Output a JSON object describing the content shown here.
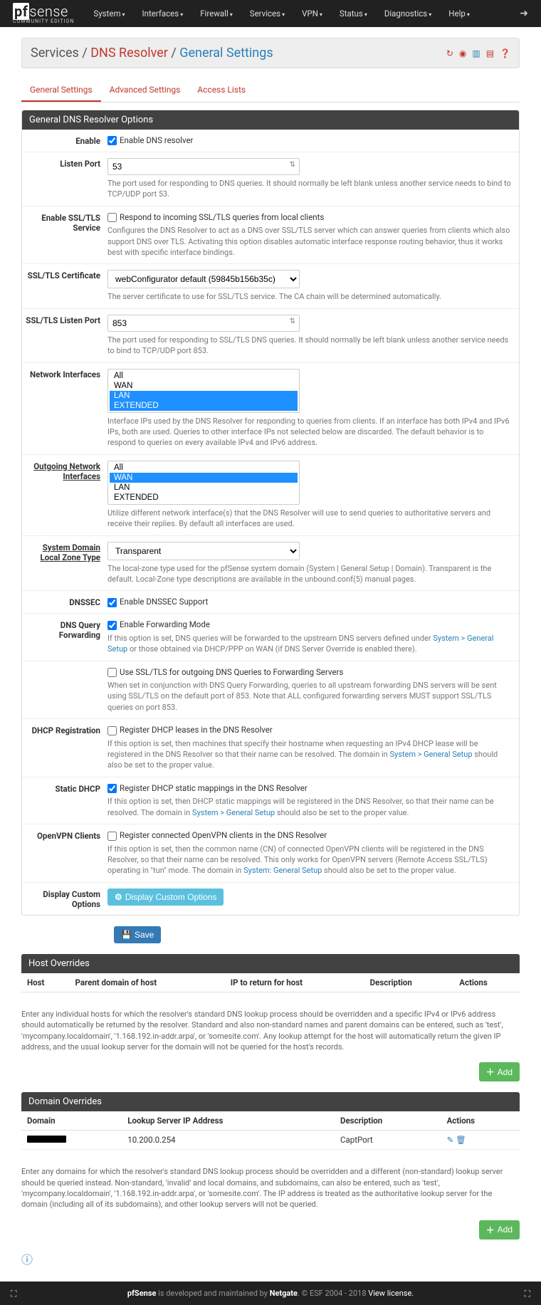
{
  "logo": {
    "brand_prefix": "pf",
    "brand_rest": "sense",
    "edition": "COMMUNITY EDITION"
  },
  "nav": [
    "System",
    "Interfaces",
    "Firewall",
    "Services",
    "VPN",
    "Status",
    "Diagnostics",
    "Help"
  ],
  "breadcrumb": {
    "a": "Services",
    "b": "DNS Resolver",
    "c": "General Settings"
  },
  "tabs": [
    "General Settings",
    "Advanced Settings",
    "Access Lists"
  ],
  "panel1_title": "General DNS Resolver Options",
  "enable": {
    "label": "Enable",
    "text": "Enable DNS resolver",
    "checked": true
  },
  "listen_port": {
    "label": "Listen Port",
    "value": "53",
    "help": "The port used for responding to DNS queries. It should normally be left blank unless another service needs to bind to TCP/UDP port 53."
  },
  "ssl_service": {
    "label": "Enable SSL/TLS Service",
    "text": "Respond to incoming SSL/TLS queries from local clients",
    "checked": false,
    "help": "Configures the DNS Resolver to act as a DNS over SSL/TLS server which can answer queries from clients which also support DNS over TLS. Activating this option disables automatic interface response routing behavior, thus it works best with specific interface bindings."
  },
  "ssl_cert": {
    "label": "SSL/TLS Certificate",
    "value": "webConfigurator default (59845b156b35c)",
    "help": "The server certificate to use for SSL/TLS service. The CA chain will be determined automatically."
  },
  "ssl_port": {
    "label": "SSL/TLS Listen Port",
    "value": "853",
    "help": "The port used for responding to SSL/TLS DNS queries. It should normally be left blank unless another service needs to bind to TCP/UDP port 853."
  },
  "net_if": {
    "label": "Network Interfaces",
    "options": [
      "All",
      "WAN",
      "LAN",
      "EXTENDED"
    ],
    "selected": [
      "LAN",
      "EXTENDED"
    ],
    "help": "Interface IPs used by the DNS Resolver for responding to queries from clients. If an interface has both IPv4 and IPv6 IPs, both are used. Queries to other interface IPs not selected below are discarded. The default behavior is to respond to queries on every available IPv4 and IPv6 address."
  },
  "out_if": {
    "label": "Outgoing Network Interfaces",
    "options": [
      "All",
      "WAN",
      "LAN",
      "EXTENDED"
    ],
    "selected": [
      "WAN"
    ],
    "help": "Utilize different network interface(s) that the DNS Resolver will use to send queries to authoritative servers and receive their replies. By default all interfaces are used."
  },
  "zone_type": {
    "label": "System Domain Local Zone Type",
    "value": "Transparent",
    "help": "The local-zone type used for the pfSense system domain (System | General Setup | Domain). Transparent is the default. Local-Zone type descriptions are available in the unbound.conf(5) manual pages."
  },
  "dnssec": {
    "label": "DNSSEC",
    "text": "Enable DNSSEC Support",
    "checked": true
  },
  "fwd": {
    "label": "DNS Query Forwarding",
    "text": "Enable Forwarding Mode",
    "checked": true,
    "help1": "If this option is set, DNS queries will be forwarded to the upstream DNS servers defined under ",
    "link": "System > General Setup",
    "help2": " or those obtained via DHCP/PPP on WAN (if DNS Server Override is enabled there)."
  },
  "fwd_ssl": {
    "text": "Use SSL/TLS for outgoing DNS Queries to Forwarding Servers",
    "checked": false,
    "help": "When set in conjunction with DNS Query Forwarding, queries to all upstream forwarding DNS servers will be sent using SSL/TLS on the default port of 853. Note that ALL configured forwarding servers MUST support SSL/TLS queries on port 853."
  },
  "dhcp_reg": {
    "label": "DHCP Registration",
    "text": "Register DHCP leases in the DNS Resolver",
    "checked": false,
    "help1": "If this option is set, then machines that specify their hostname when requesting an IPv4 DHCP lease will be registered in the DNS Resolver so that their name can be resolved. The domain in ",
    "link": "System > General Setup",
    "help2": " should also be set to the proper value."
  },
  "static_dhcp": {
    "label": "Static DHCP",
    "text": "Register DHCP static mappings in the DNS Resolver",
    "checked": true,
    "help1": "If this option is set, then DHCP static mappings will be registered in the DNS Resolver, so that their name can be resolved. The domain in ",
    "link": "System > General Setup",
    "help2": " should also be set to the proper value."
  },
  "openvpn": {
    "label": "OpenVPN Clients",
    "text": "Register connected OpenVPN clients in the DNS Resolver",
    "checked": false,
    "help1": "If this option is set, then the common name (CN) of connected OpenVPN clients will be registered in the DNS Resolver, so that their name can be resolved. This only works for OpenVPN servers (Remote Access SSL/TLS) operating in \"tun\" mode. The domain in ",
    "link": "System: General Setup",
    "help2": " should also be set to the proper value."
  },
  "custom": {
    "label": "Display Custom Options",
    "btn": "Display Custom Options"
  },
  "save_btn": "Save",
  "host_ov": {
    "title": "Host Overrides",
    "cols": [
      "Host",
      "Parent domain of host",
      "IP to return for host",
      "Description",
      "Actions"
    ],
    "desc": "Enter any individual hosts for which the resolver's standard DNS lookup process should be overridden and a specific IPv4 or IPv6 address should automatically be returned by the resolver. Standard and also non-standard names and parent domains can be entered, such as 'test', 'mycompany.localdomain', '1.168.192.in-addr.arpa', or 'somesite.com'. Any lookup attempt for the host will automatically return the given IP address, and the usual lookup server for the domain will not be queried for the host's records."
  },
  "dom_ov": {
    "title": "Domain Overrides",
    "cols": [
      "Domain",
      "Lookup Server IP Address",
      "Description",
      "Actions"
    ],
    "row": {
      "ip": "10.200.0.254",
      "desc": "CaptPort"
    },
    "desc2": "Enter any domains for which the resolver's standard DNS lookup process should be overridden and a different (non-standard) lookup server should be queried instead. Non-standard, 'invalid' and local domains, and subdomains, can also be entered, such as 'test', 'mycompany.localdomain', '1.168.192.in-addr.arpa', or 'somesite.com'. The IP address is treated as the authoritative lookup server for the domain (including all of its subdomains), and other lookup servers will not be queried."
  },
  "add_btn": "Add",
  "footer": {
    "a": "pfSense",
    "b": " is developed and maintained by ",
    "c": "Netgate",
    "d": ". © ESF 2004 - 2018 ",
    "e": "View license."
  }
}
